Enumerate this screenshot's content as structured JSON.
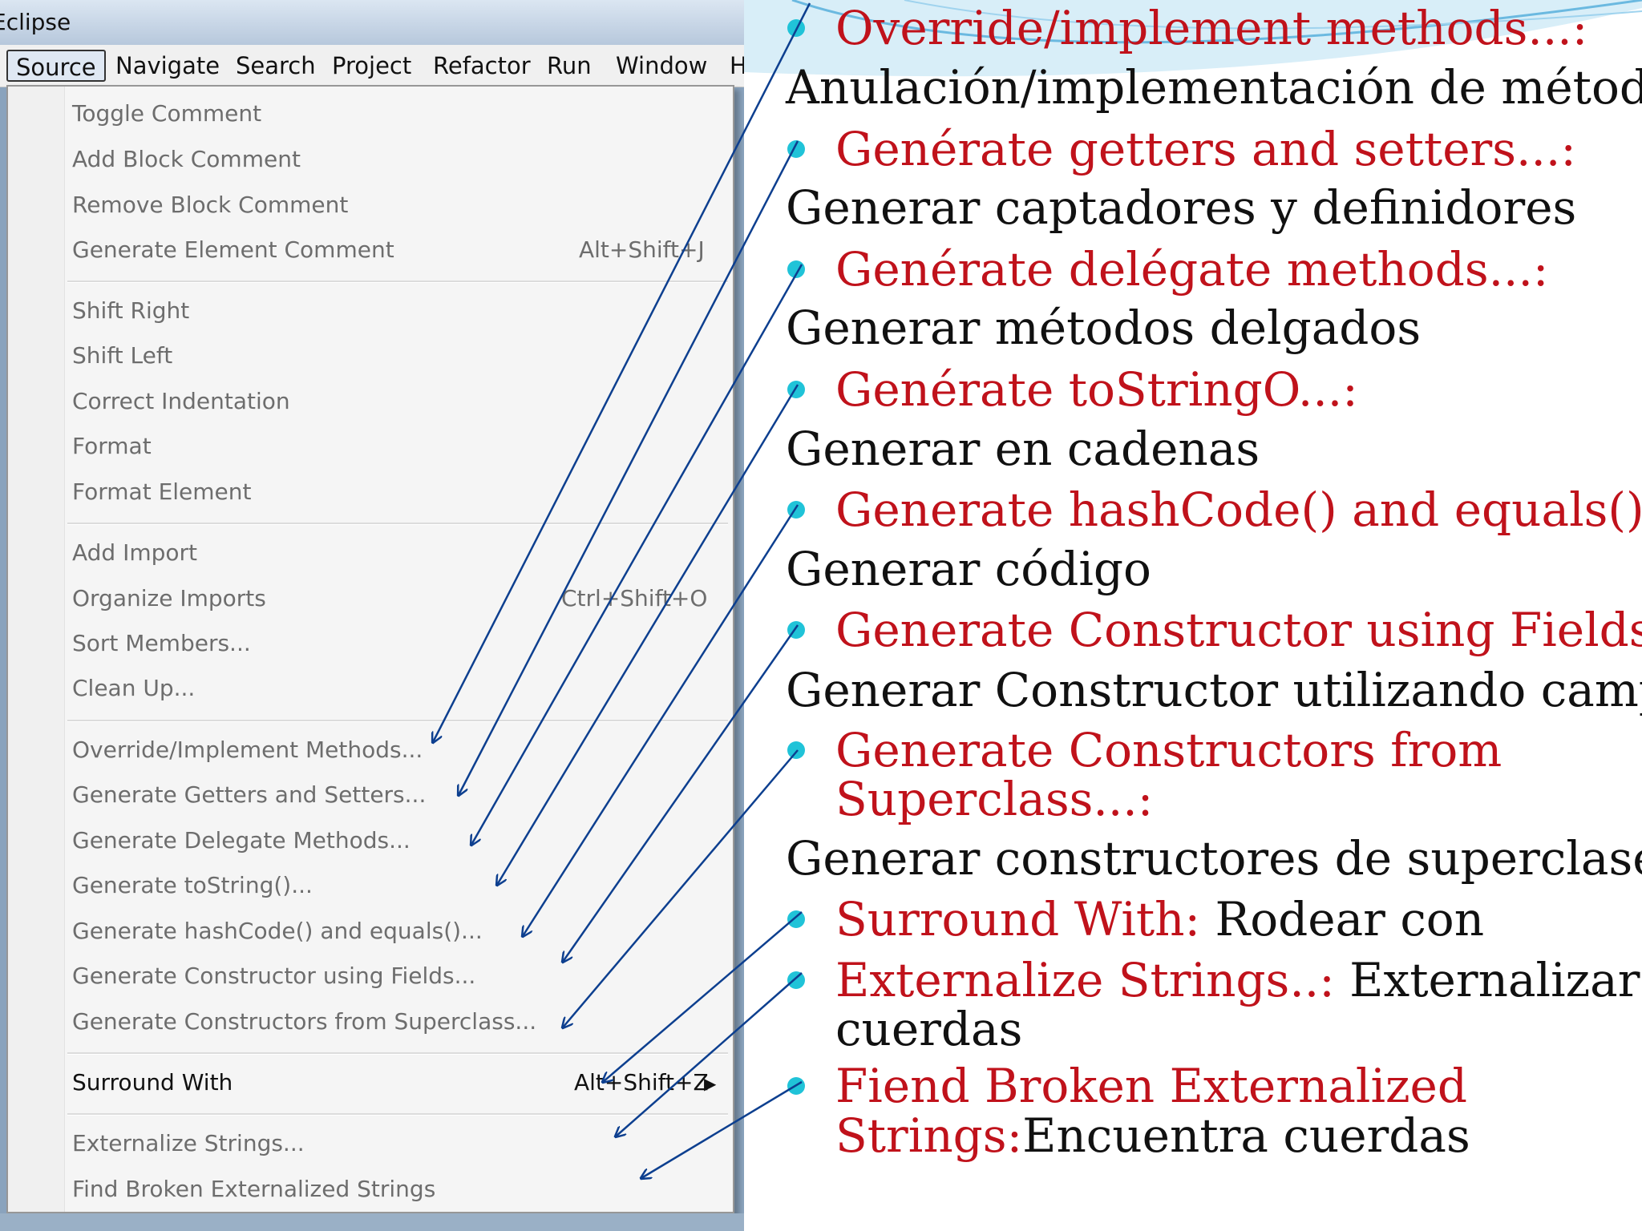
{
  "window": {
    "title": "Eclipse"
  },
  "menubar": {
    "items": [
      "Source",
      "Navigate",
      "Search",
      "Project",
      "Refactor",
      "Run",
      "Window",
      "H"
    ]
  },
  "source_menu": {
    "groups": [
      [
        {
          "label": "Toggle Comment",
          "shortcut": ""
        },
        {
          "label": "Add Block Comment",
          "shortcut": ""
        },
        {
          "label": "Remove Block Comment",
          "shortcut": ""
        },
        {
          "label": "Generate Element Comment",
          "shortcut": "Alt+Shift+J"
        }
      ],
      [
        {
          "label": "Shift Right",
          "shortcut": ""
        },
        {
          "label": "Shift Left",
          "shortcut": ""
        },
        {
          "label": "Correct Indentation",
          "shortcut": ""
        },
        {
          "label": "Format",
          "shortcut": ""
        },
        {
          "label": "Format Element",
          "shortcut": ""
        }
      ],
      [
        {
          "label": "Add Import",
          "shortcut": ""
        },
        {
          "label": "Organize Imports",
          "shortcut": "Ctrl+Shift+O"
        },
        {
          "label": "Sort Members...",
          "shortcut": ""
        },
        {
          "label": "Clean Up...",
          "shortcut": ""
        }
      ],
      [
        {
          "label": "Override/Implement Methods...",
          "shortcut": ""
        },
        {
          "label": "Generate Getters and Setters...",
          "shortcut": ""
        },
        {
          "label": "Generate Delegate Methods...",
          "shortcut": ""
        },
        {
          "label": "Generate toString()...",
          "shortcut": ""
        },
        {
          "label": "Generate hashCode() and equals()...",
          "shortcut": ""
        },
        {
          "label": "Generate Constructor using Fields...",
          "shortcut": ""
        },
        {
          "label": "Generate Constructors from Superclass...",
          "shortcut": ""
        }
      ],
      [
        {
          "label": "Surround With",
          "shortcut": "Alt+Shift+Z",
          "enabled": true,
          "submenu": true
        }
      ],
      [
        {
          "label": "Externalize Strings...",
          "shortcut": ""
        },
        {
          "label": "Find Broken Externalized Strings",
          "shortcut": ""
        }
      ]
    ]
  },
  "slide": {
    "entries": [
      {
        "en": "Override/implement methods...:",
        "es_line": "Anulación/implementación de métodos"
      },
      {
        "en": "Genérate getters and setters...:",
        "es_line": "Generar captadores y definidores"
      },
      {
        "en": "Genérate delégate methods...:",
        "es_line": "Generar métodos delgados"
      },
      {
        "en": "Genérate toStringO...:",
        "es_line": "Generar en cadenas"
      },
      {
        "en": "Generate hashCode() and equals()...:",
        "es_line": "Generar código"
      },
      {
        "en": "Generate Constructor using Fields...:",
        "es_line": "Generar Constructor utilizando campos"
      },
      {
        "en": "Generate Constructors from",
        "en2": "Superclass...:",
        "es_line": "Generar constructores de superclase"
      },
      {
        "en": "Surround With:",
        "es_inline": " Rodear con"
      },
      {
        "en": "Externalize Strings..:",
        "es_inline": " Externalizar las",
        "es2": "cuerdas"
      },
      {
        "en": "Fiend Broken Externalized",
        "en2": "Strings:",
        "es_inline2": "Encuentra cuerdas"
      }
    ]
  },
  "colors": {
    "english": "#c0121b",
    "spanish": "#111111",
    "bullet": "#20c3d8",
    "arrow": "#0d3f8f"
  }
}
